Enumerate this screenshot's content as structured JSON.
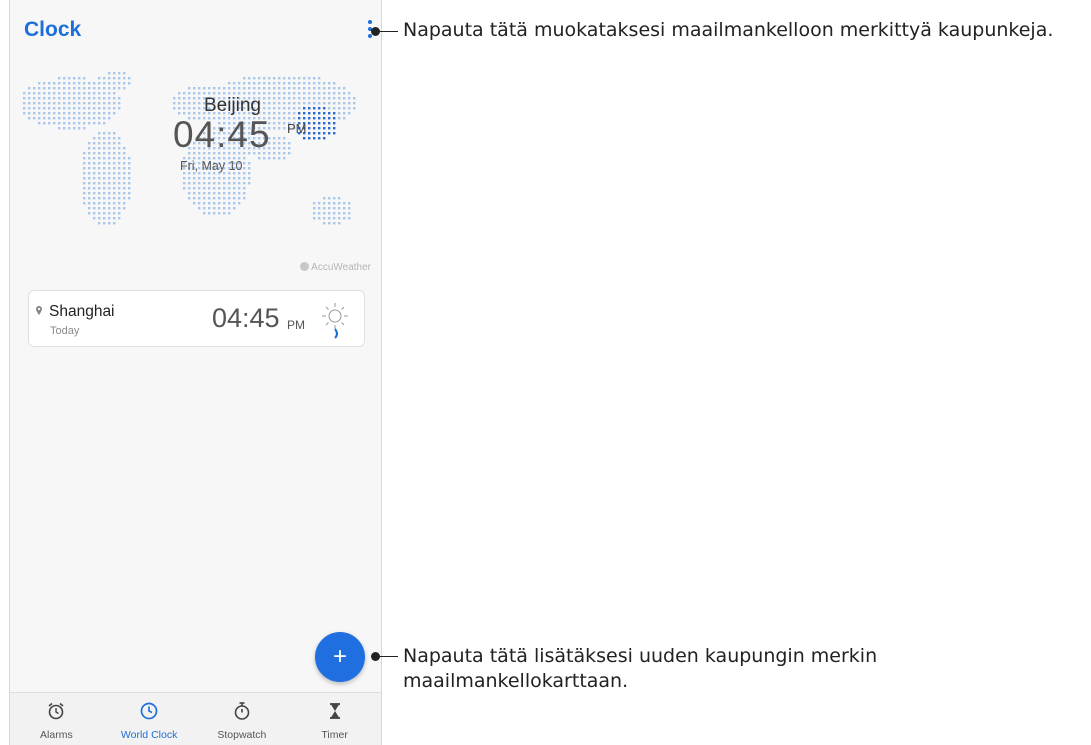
{
  "app": {
    "title": "Clock"
  },
  "featured": {
    "city": "Beijing",
    "time": "04:45",
    "ampm": "PM",
    "date": "Fri, May 10"
  },
  "attribution": "AccuWeather",
  "cities": [
    {
      "name": "Shanghai",
      "day": "Today",
      "time": "04:45",
      "ampm": "PM"
    }
  ],
  "fab": {
    "symbol": "+"
  },
  "nav": {
    "items": [
      {
        "label": "Alarms",
        "icon": "alarm-clock-icon"
      },
      {
        "label": "World Clock",
        "icon": "clock-icon"
      },
      {
        "label": "Stopwatch",
        "icon": "stopwatch-icon"
      },
      {
        "label": "Timer",
        "icon": "hourglass-icon"
      }
    ],
    "active": "World Clock"
  },
  "callouts": {
    "menu": "Napauta tätä muokataksesi maailmankelloon merkittyä kaupunkeja.",
    "add_line1": "Napauta tätä lisätäksesi uuden kaupungin merkin",
    "add_line2": "maailmankellokarttaan."
  },
  "colors": {
    "accent": "#1e6fd9",
    "map_dots": "#a9c6ec",
    "map_highlight": "#2a6ad0"
  }
}
